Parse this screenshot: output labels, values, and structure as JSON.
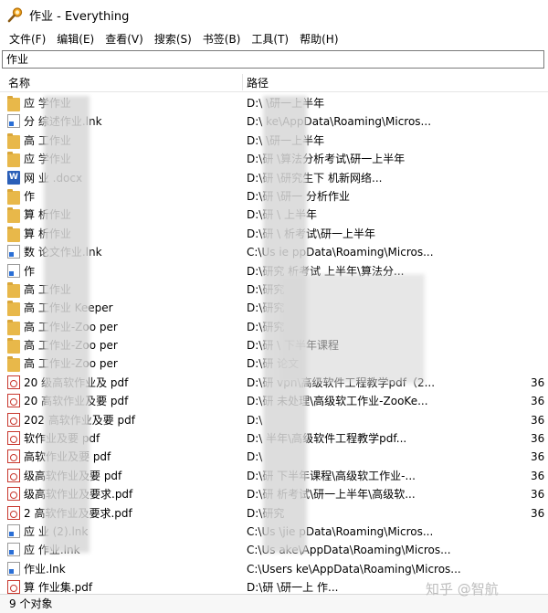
{
  "window": {
    "title": "作业 - Everything",
    "app_icon": "magnifier-icon"
  },
  "menu": [
    "文件(F)",
    "编辑(E)",
    "查看(V)",
    "搜索(S)",
    "书签(B)",
    "工具(T)",
    "帮助(H)"
  ],
  "search": {
    "value": "作业"
  },
  "columns": {
    "name": "名称",
    "path": "路径"
  },
  "rows": [
    {
      "icon": "folder",
      "name": "应   学作业",
      "path": "D:\\     \\研一上半年",
      "size": ""
    },
    {
      "icon": "lnk",
      "name": "分      综述作业.lnk",
      "path": "D:\\         ke\\AppData\\Roaming\\Micros...",
      "size": ""
    },
    {
      "icon": "folder",
      "name": "高      工作业",
      "path": "D:\\          \\研一上半年",
      "size": ""
    },
    {
      "icon": "folder",
      "name": "应      学作业",
      "path": "D:\\研      \\算法分析考试\\研一上半年",
      "size": ""
    },
    {
      "icon": "doc",
      "name": "网       业        .docx",
      "path": "D:\\研      \\研究生下                机新网络...",
      "size": ""
    },
    {
      "icon": "folder",
      "name": "作",
      "path": "D:\\研      \\研一               分析作业",
      "size": ""
    },
    {
      "icon": "folder",
      "name": "算      析作业",
      "path": "D:\\研      \\          上半年",
      "size": ""
    },
    {
      "icon": "folder",
      "name": "算      析作业",
      "path": "D:\\研      \\       析考试\\研一上半年",
      "size": ""
    },
    {
      "icon": "lnk",
      "name": "数      论文作业.lnk",
      "path": "C:\\Us       ie      ppData\\Roaming\\Micros...",
      "size": ""
    },
    {
      "icon": "lnk",
      "name": "作",
      "path": "D:\\研究          析考试    上半年\\算法分...",
      "size": ""
    },
    {
      "icon": "folder",
      "name": "高      工作业",
      "path": "D:\\研究",
      "size": ""
    },
    {
      "icon": "folder",
      "name": "高      工作业       Keeper",
      "path": "D:\\研究",
      "size": ""
    },
    {
      "icon": "folder",
      "name": "高      工作业-Zoo      per",
      "path": "D:\\研究",
      "size": ""
    },
    {
      "icon": "folder",
      "name": "高      工作业-Zoo      per",
      "path": "D:\\研      \\        下半年课程",
      "size": ""
    },
    {
      "icon": "folder",
      "name": "高      工作业-Zoo      per",
      "path": "D:\\研              论文",
      "size": ""
    },
    {
      "icon": "pdf",
      "name": "20     级高软作业及      pdf",
      "path": "D:\\研        vpn\\高级软件工程教学pdf（2...",
      "size": "36"
    },
    {
      "icon": "pdf",
      "name": "20     高软作业及要      pdf",
      "path": "D:\\研          未处理\\高级软工作业-ZooKe...",
      "size": "36"
    },
    {
      "icon": "pdf",
      "name": "202    高软作业及要      pdf",
      "path": "D:\\",
      "size": "36"
    },
    {
      "icon": "pdf",
      "name": "          软作业及要      pdf",
      "path": "D:\\          半年\\高级软件工程教学pdf...",
      "size": "36"
    },
    {
      "icon": "pdf",
      "name": "          高软作业及要      pdf",
      "path": "D:\\",
      "size": "36"
    },
    {
      "icon": "pdf",
      "name": "          级高软作业及要      pdf",
      "path": "D:\\研         下半年课程\\高级软工作业-...",
      "size": "36"
    },
    {
      "icon": "pdf",
      "name": "          级高软作业及要求.pdf",
      "path": "D:\\研          析考试\\研一上半年\\高级软...",
      "size": "36"
    },
    {
      "icon": "pdf",
      "name": "2          高软作业及要求.pdf",
      "path": "D:\\研究",
      "size": "36"
    },
    {
      "icon": "lnk",
      "name": "应          业 (2).lnk",
      "path": "C:\\Us     \\jie      pData\\Roaming\\Micros...",
      "size": ""
    },
    {
      "icon": "lnk",
      "name": "应       作业.lnk",
      "path": "C:\\Us       ake\\AppData\\Roaming\\Micros...",
      "size": ""
    },
    {
      "icon": "lnk",
      "name": "          作业.lnk",
      "path": "C:\\Users       ke\\AppData\\Roaming\\Micros...",
      "size": ""
    },
    {
      "icon": "pdf",
      "name": "算          作业集.pdf",
      "path": "D:\\研         \\研一上        作...",
      "size": ""
    }
  ],
  "status": "9 个对象",
  "watermark": "知乎 @智航"
}
